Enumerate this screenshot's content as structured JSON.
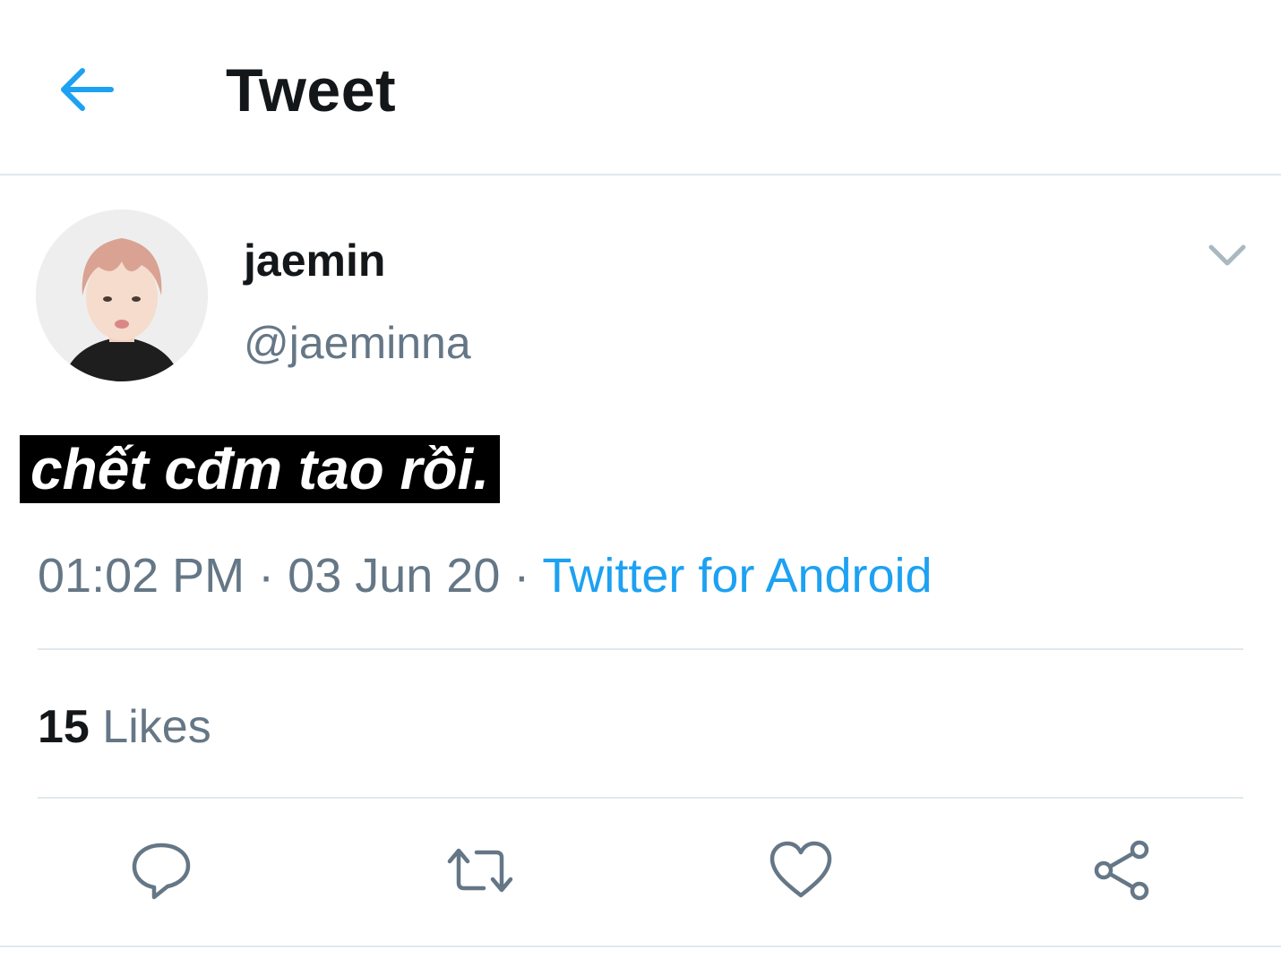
{
  "header": {
    "title": "Tweet",
    "back_icon": "arrow-left-icon"
  },
  "tweet": {
    "author": {
      "display_name": "jaemin",
      "handle": "@jaeminna"
    },
    "text": "chết cđm tao rồi.",
    "time": "01:02 PM",
    "separator": "·",
    "date": "03 Jun 20",
    "source": "Twitter for Android",
    "likes": {
      "count": "15",
      "label": "Likes"
    }
  },
  "actions": [
    {
      "name": "reply",
      "icon": "reply-icon"
    },
    {
      "name": "retweet",
      "icon": "retweet-icon"
    },
    {
      "name": "like",
      "icon": "heart-icon"
    },
    {
      "name": "share",
      "icon": "share-icon"
    }
  ],
  "colors": {
    "accent": "#1da1f2",
    "secondary_text": "#657786",
    "primary_text": "#14171a",
    "divider": "#e1e8ed",
    "icon": "#657786"
  }
}
